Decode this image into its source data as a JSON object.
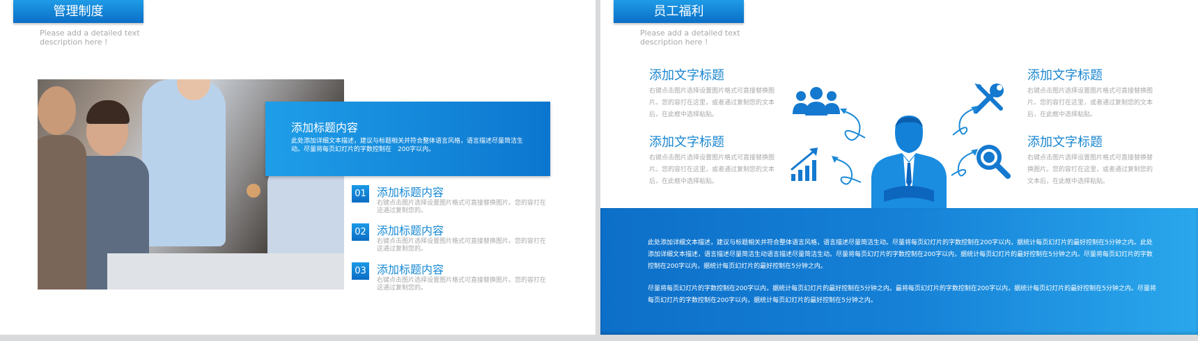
{
  "left_slide": {
    "title": "管理制度",
    "subdesc": "Please add a detailed text description here !",
    "callout": {
      "title": "添加标题内容",
      "desc": "此处添加详细文本描述，建议与标题相关并符合整体语言风格，语言描述尽量简洁生动。尽量将每页幻灯片的字数控制在　200字以内。"
    },
    "items": [
      {
        "num": "01",
        "title": "添加标题内容",
        "desc": "右键点击图片选择设置图片格式可直接替换图片。您的容打在这通过复制您的。"
      },
      {
        "num": "02",
        "title": "添加标题内容",
        "desc": "右键点击图片选择设置图片格式可直接替换图片。您的容打在这通过复制您的。"
      },
      {
        "num": "03",
        "title": "添加标题内容",
        "desc": "右键点击图片选择设置图片格式可直接替换图片。您的容打在这通过复制您的。"
      }
    ]
  },
  "right_slide": {
    "title": "员工福利",
    "subdesc": "Please add a detailed text description here !",
    "features": [
      {
        "title": "添加文字标题",
        "desc": "右键点击图片选择设置图片格式可直接替换图片。您的容打在这里，或者通过复制您的文本后，在此框中选择粘贴。"
      },
      {
        "title": "添加文字标题",
        "desc": "右键点击图片选择设置图片格式可直接替换图片。您的容打在这里，或者通过复制您的文本后，在此框中选择粘贴。"
      },
      {
        "title": "添加文字标题",
        "desc": "右键点击图片选择设置图片格式可直接替换图片。您的容打在这里，或者通过复制您的文本后，在此框中选择粘贴。"
      },
      {
        "title": "添加文字标题",
        "desc": "右键点击图片选择设置图片格式可直接替换替换图片。您的容打在这里，或者通过复制您的文本后，在此框中选择粘贴。"
      }
    ],
    "band": {
      "p1": "此处添加详细文本描述，建议与标题相关并符合整体语言风格，语言描述尽量简洁生动。尽量将每页幻灯片的字数控制在200字以内，据统计每页幻灯片的最好控制在5分钟之内。此处添加详细文本描述，语言描述尽量简洁生动语言描述尽量简洁生动。尽量将每页幻灯片的字数控制在200字以内，据统计每页幻灯片的最好控制在5分钟之内。尽量将每页幻灯片的字数控制在200字以内，据统计每页幻灯片的最好控制在5分钟之内。",
      "p2": "尽量将每页幻灯片的字数控制在200字以内，据统计每页幻灯片的最好控制在5分钟之内。最将每页幻灯片的字数控制在200字以内，据统计每页幻灯片的最好控制在5分钟之内。尽量将每页幻灯片的字数控制在200字以内，据统计每页幻灯片的最好控制在5分钟之内。"
    },
    "icons": [
      "team-icon",
      "growth-chart-icon",
      "tools-icon",
      "search-icon",
      "businessman-icon"
    ]
  },
  "colors": {
    "accent": "#0c76cf",
    "accent_light": "#2aa7ec",
    "muted_text": "#a8a8a8",
    "title_blue": "#1a86d0"
  }
}
